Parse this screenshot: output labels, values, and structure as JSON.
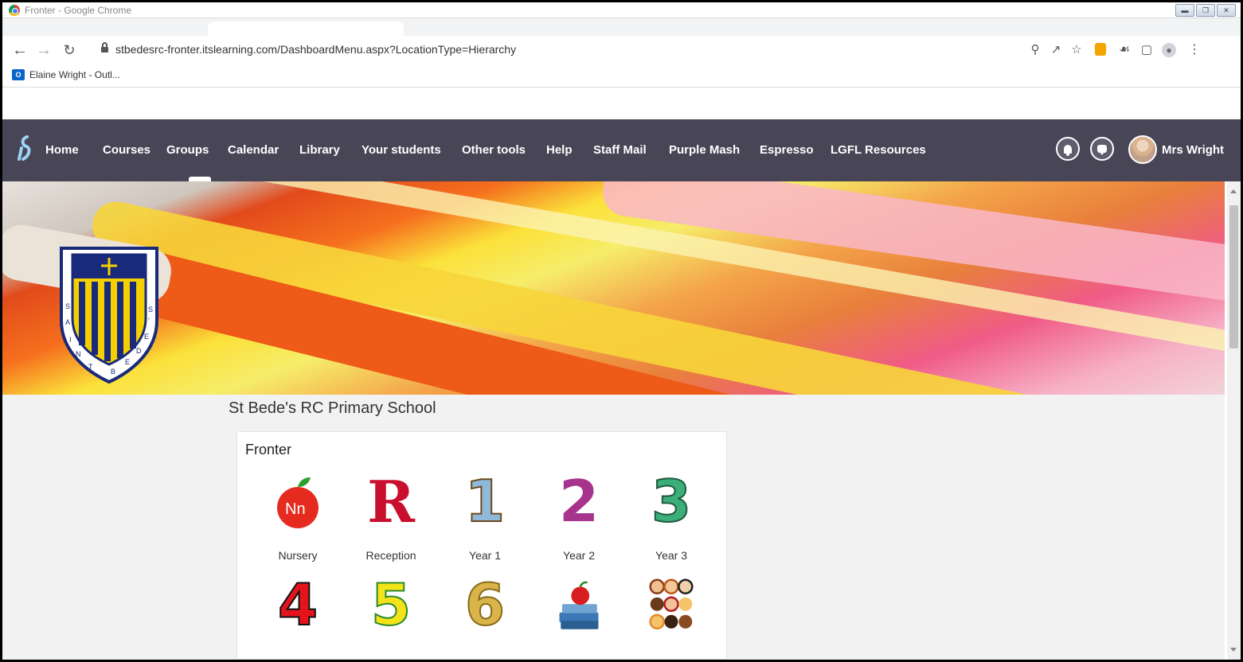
{
  "window": {
    "title": "Fronter - Google Chrome",
    "controls": [
      "minimize",
      "restore",
      "close"
    ]
  },
  "browser": {
    "url": "stbedesrc-fronter.itslearning.com/DashboardMenu.aspx?LocationType=Hierarchy",
    "bookmarks": [
      {
        "label": "Elaine Wright - Outl...",
        "icon": "outlook-icon"
      }
    ]
  },
  "nav": {
    "items": [
      {
        "label": "Home"
      },
      {
        "label": "Courses"
      },
      {
        "label": "Groups"
      },
      {
        "label": "Calendar"
      },
      {
        "label": "Library"
      },
      {
        "label": "Your students"
      },
      {
        "label": "Other tools"
      },
      {
        "label": "Help"
      },
      {
        "label": "Staff Mail"
      },
      {
        "label": "Purple Mash"
      },
      {
        "label": "Espresso"
      },
      {
        "label": "LGFL Resources"
      }
    ],
    "active": "Groups",
    "user": "Mrs Wright"
  },
  "page": {
    "school_name": "St Bede's RC Primary School",
    "card_title": "Fronter",
    "tiles": [
      {
        "label": "Nursery",
        "icon": "apple-nn-icon"
      },
      {
        "label": "Reception",
        "icon": "letter-r-icon"
      },
      {
        "label": "Year 1",
        "icon": "number-1-icon"
      },
      {
        "label": "Year 2",
        "icon": "number-2-icon"
      },
      {
        "label": "Year 3",
        "icon": "number-3-icon"
      },
      {
        "label": "",
        "icon": "number-4-icon"
      },
      {
        "label": "",
        "icon": "number-5-icon"
      },
      {
        "label": "",
        "icon": "number-6-icon"
      },
      {
        "label": "",
        "icon": "books-apple-icon"
      },
      {
        "label": "",
        "icon": "children-faces-icon"
      }
    ],
    "crest_letters": "SAINT BEDE'S"
  },
  "colors": {
    "nav_bg": "#484557",
    "page_bg": "#f2f2f2",
    "crest_yellow": "#f5d000",
    "crest_navy": "#1a2a7a"
  }
}
